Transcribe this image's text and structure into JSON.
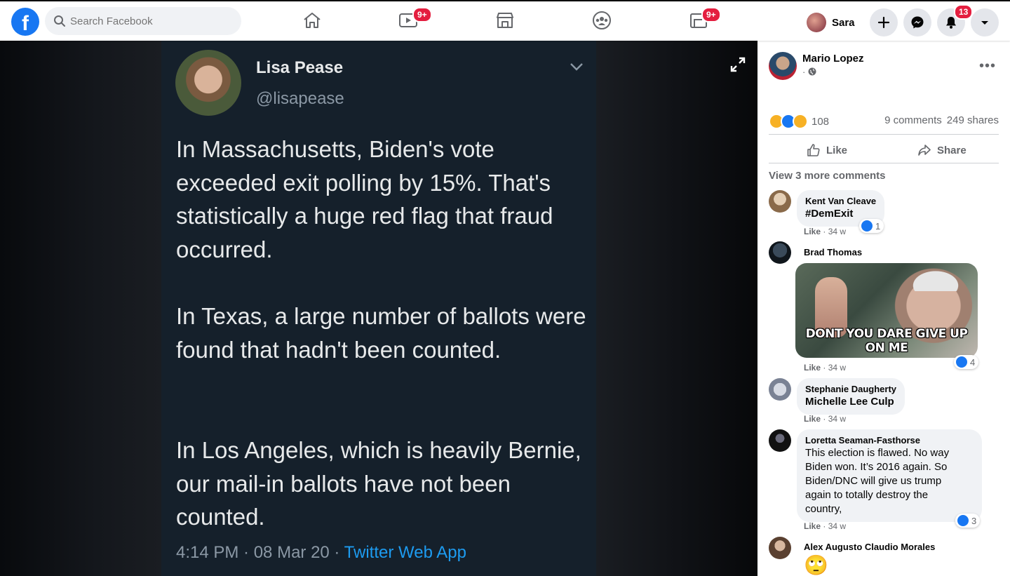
{
  "topbar": {
    "search_placeholder": "Search Facebook",
    "watch_badge": "9+",
    "pages_badge": "9+",
    "user_name": "Sara",
    "notifications_badge": "13",
    "brand_color": "#1877f2",
    "badge_color": "#e41e3f"
  },
  "tweet": {
    "name": "Lisa Pease",
    "handle": "@lisapease",
    "paragraphs": [
      "In Massachusetts, Biden's vote exceeded exit polling by 15%. That's statistically a huge red flag that fraud occurred.",
      "In Texas, a large number of ballots were found that hadn't been counted.",
      "In Los Angeles, which is heavily Bernie, our mail-in ballots have not been counted."
    ],
    "time": "4:14 PM · 08 Mar 20 · ",
    "app": "Twitter Web App",
    "background": "#15202b",
    "link_color": "#1d9bf0"
  },
  "post": {
    "author": "Mario Lopez",
    "sub": "· ",
    "reaction_count": "108",
    "comments": "9 comments",
    "shares": "249 shares",
    "like_label": "Like",
    "share_label": "Share",
    "view_more": "View 3 more comments"
  },
  "comments": [
    {
      "author": "Kent Van Cleave",
      "text": "#DemExit",
      "like": "Like",
      "time": "34 w",
      "reactions": "1"
    },
    {
      "author": "Brad Thomas",
      "image_caption": "DONT YOU DARE GIVE UP ON ME",
      "like": "Like",
      "time": "34 w",
      "reactions": "4"
    },
    {
      "author": "Stephanie Daugherty",
      "text": "Michelle Lee Culp",
      "like": "Like",
      "time": "34 w"
    },
    {
      "author": "Loretta Seaman-Fasthorse",
      "text_lines": [
        "This election is flawed. No way",
        "Biden won. It’s 2016 again. So",
        "Biden/DNC will give us trump",
        "again to totally destroy the",
        "country,"
      ],
      "like": "Like",
      "time": "34 w",
      "reactions": "3"
    },
    {
      "author": "Alex Augusto Claudio Morales",
      "emoji": "🙄"
    }
  ]
}
